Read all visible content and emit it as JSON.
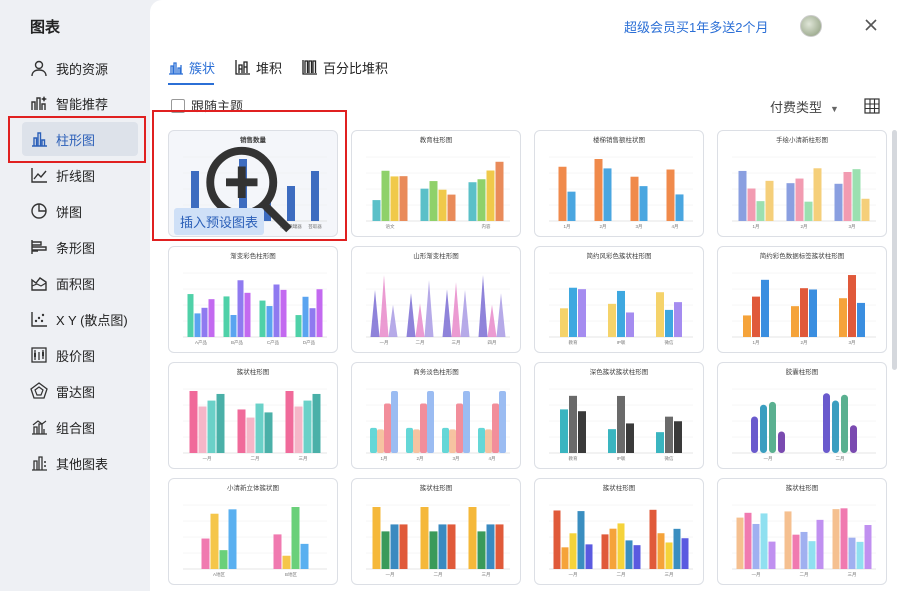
{
  "sidebar": {
    "title": "图表",
    "items": [
      {
        "label": "我的资源",
        "icon": "user-icon"
      },
      {
        "label": "智能推荐",
        "icon": "smart-recommend-icon"
      },
      {
        "label": "柱形图",
        "icon": "bar-chart-icon"
      },
      {
        "label": "折线图",
        "icon": "line-chart-icon"
      },
      {
        "label": "饼图",
        "icon": "pie-chart-icon"
      },
      {
        "label": "条形图",
        "icon": "horizontal-bar-icon"
      },
      {
        "label": "面积图",
        "icon": "area-chart-icon"
      },
      {
        "label": "X Y (散点图)",
        "icon": "scatter-icon"
      },
      {
        "label": "股价图",
        "icon": "stock-chart-icon"
      },
      {
        "label": "雷达图",
        "icon": "radar-chart-icon"
      },
      {
        "label": "组合图",
        "icon": "combo-chart-icon"
      },
      {
        "label": "其他图表",
        "icon": "other-chart-icon"
      }
    ],
    "active_index": 2
  },
  "header": {
    "promo": "超级会员买1年多送2个月"
  },
  "tabs": [
    {
      "label": "簇状",
      "active": true
    },
    {
      "label": "堆积",
      "active": false
    },
    {
      "label": "百分比堆积",
      "active": false
    }
  ],
  "toolbar": {
    "follow_theme": "跟随主题",
    "pay_type": "付费类型"
  },
  "selected_card": {
    "insert_label": "插入预设图表"
  },
  "templates": [
    {
      "title": "销售数量",
      "xlabels": [
        "",
        "",
        "",
        "",
        "iyes鼎罐器",
        "芸取器"
      ],
      "values": [
        50,
        12,
        62,
        20,
        35
      ]
    },
    {
      "title": "教育柱形图",
      "xlabels": [
        "语文",
        "",
        "内容"
      ],
      "values": []
    },
    {
      "title": "楼梯销售额柱状图",
      "xlabels": [
        "1月",
        "2月",
        "3月",
        "4月"
      ],
      "values": [
        98,
        53,
        112,
        95,
        80,
        63,
        93,
        48
      ]
    },
    {
      "title": "手绘小清新柱形图",
      "xlabels": [
        "1月",
        "2月",
        "3月"
      ],
      "values": []
    },
    {
      "title": "渐变彩色柱形图",
      "xlabels": [
        "A产品",
        "B产品",
        "C产品",
        "D产品"
      ],
      "values": []
    },
    {
      "title": "山形渐变柱形图",
      "xlabels": [
        "一月",
        "二月",
        "三月",
        "四月"
      ],
      "values": [
        73,
        96,
        50,
        68,
        52,
        88,
        74,
        85
      ]
    },
    {
      "title": "简约风彩色簇状柱形图",
      "xlabels": [
        "教育",
        "IP联",
        "微信"
      ],
      "values": []
    },
    {
      "title": "简约彩色数据标签簇状柱形图",
      "xlabels": [
        "1月",
        "2月",
        "3月"
      ],
      "values": []
    },
    {
      "title": "簇状柱形图",
      "xlabels": [
        "一月",
        "二月",
        "三月"
      ],
      "values": [
        84,
        63,
        71,
        80,
        59,
        48,
        67,
        55
      ]
    },
    {
      "title": "商务淡色柱形图",
      "xlabels": [
        "1月",
        "2月",
        "3月",
        "4月"
      ],
      "values": [
        36,
        34,
        71,
        89
      ]
    },
    {
      "title": "深色簇状簇状柱形图",
      "xlabels": [
        "教育",
        "IP联",
        "微信"
      ],
      "values": []
    },
    {
      "title": "胶囊柱形图",
      "xlabels": [
        "一月",
        "二月"
      ],
      "values": []
    },
    {
      "title": "小清新立体簇状图",
      "xlabels": [
        "A地区",
        "B地区"
      ],
      "values": [
        485,
        880,
        300,
        950,
        551,
        211,
        987,
        400
      ]
    },
    {
      "title": "簇状柱形图",
      "xlabels": [
        "一月",
        "二月",
        "三月"
      ],
      "values": [
        89,
        54,
        64,
        64
      ]
    },
    {
      "title": "簇状柱形图",
      "xlabels": [
        "一月",
        "二月",
        "三月"
      ],
      "values": []
    },
    {
      "title": "簇状柱形图",
      "xlabels": [
        "一月",
        "二月",
        "三月"
      ],
      "values": []
    }
  ],
  "colors": {
    "accent": "#2b6fd6",
    "highlight_box": "#e02020"
  }
}
